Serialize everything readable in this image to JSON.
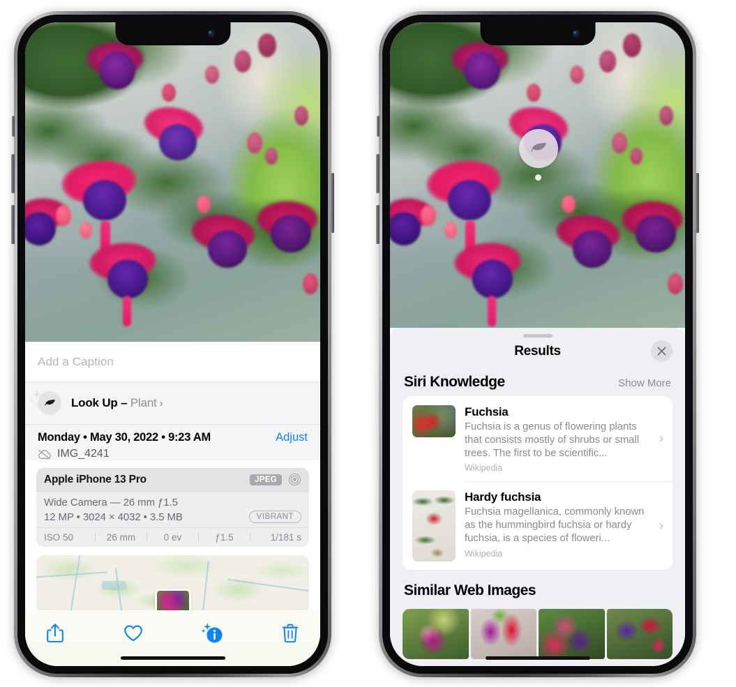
{
  "left_phone": {
    "photo": {
      "alt": "fuchsia-flowers-photo"
    },
    "caption": {
      "placeholder": "Add a Caption",
      "value": ""
    },
    "lookup": {
      "icon": "leaf-icon",
      "label": "Look Up – ",
      "subject": "Plant",
      "chevron": "›"
    },
    "metadata": {
      "date": "Monday • May 30, 2022 • 9:23 AM",
      "adjust_label": "Adjust",
      "cloud_icon": "icloud-slash-icon",
      "filename": "IMG_4241"
    },
    "camera_card": {
      "model": "Apple iPhone 13 Pro",
      "format_badge": "JPEG",
      "lens_icon": "aperture-icon",
      "lens_line": "Wide Camera — 26 mm ƒ1.5",
      "size_line": "12 MP • 3024 × 4032 • 3.5 MB",
      "style_badge": "VIBRANT",
      "exif": [
        "ISO 50",
        "26 mm",
        "0 ev",
        "ƒ1.5",
        "1/181 s"
      ]
    },
    "map": {
      "label": "location-map"
    },
    "toolbar": [
      {
        "name": "share-button",
        "icon": "share-icon"
      },
      {
        "name": "favorite-button",
        "icon": "heart-icon"
      },
      {
        "name": "info-button",
        "icon": "info-sparkle-icon"
      },
      {
        "name": "delete-button",
        "icon": "trash-icon"
      }
    ],
    "accent_color": "#0a84ff"
  },
  "right_phone": {
    "visual_lookup_badge": {
      "icon": "leaf-icon"
    },
    "sheet": {
      "title": "Results",
      "close_icon": "close-icon",
      "sections": [
        {
          "title": "Siri Knowledge",
          "action": "Show More",
          "items": [
            {
              "title": "Fuchsia",
              "description": "Fuchsia is a genus of flowering plants that consists mostly of shrubs or small trees. The first to be scientific...",
              "source": "Wikipedia",
              "thumb": "fuchsia-red-flowers-thumb",
              "chevron": "›"
            },
            {
              "title": "Hardy fuchsia",
              "description": "Fuchsia magellanica, commonly known as the hummingbird fuchsia or hardy fuchsia, is a species of floweri...",
              "source": "Wikipedia",
              "thumb": "hardy-fuchsia-branch-thumb",
              "chevron": "›"
            }
          ]
        },
        {
          "title": "Similar Web Images",
          "action": "",
          "images": [
            "fuchsia-pink-purple-bloom-1",
            "fuchsia-red-magenta-bloom-2",
            "fuchsia-bush-buds-3",
            "fuchsia-purple-red-cluster-4"
          ]
        }
      ]
    }
  }
}
